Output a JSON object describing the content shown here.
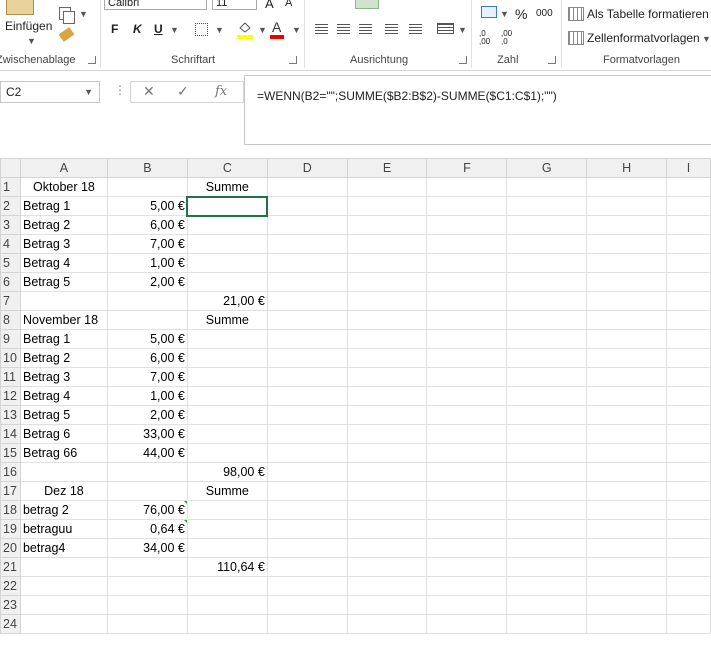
{
  "ribbon": {
    "clipboard": {
      "paste_label": "Einfügen",
      "group_label": "Zwischenablage"
    },
    "font": {
      "font_name": "Calibri",
      "font_size": "11",
      "bold": "F",
      "italic": "K",
      "underline": "U",
      "group_label": "Schriftart"
    },
    "alignment": {
      "group_label": "Ausrichtung"
    },
    "number": {
      "percent": "%",
      "thousands": "000",
      "inc_decimal": ",0 ,00",
      "dec_decimal": ",00 ,0",
      "group_label": "Zahl"
    },
    "styles": {
      "table_format": "Als Tabelle formatieren",
      "cell_styles": "Zellenformatvorlagen",
      "group_label": "Formatvorlagen"
    }
  },
  "formula_bar": {
    "name_box": "C2",
    "formula": "=WENN(B2=\"\";SUMME($B2:B$2)-SUMME($C1:C$1);\"\")"
  },
  "sheet": {
    "columns": [
      "A",
      "B",
      "C",
      "D",
      "E",
      "F",
      "G",
      "H",
      "I"
    ],
    "rows": [
      {
        "n": "1",
        "a": "Oktober 18",
        "b": "",
        "c": "Summe"
      },
      {
        "n": "2",
        "a": "Betrag 1",
        "b": "5,00 €",
        "c": ""
      },
      {
        "n": "3",
        "a": "Betrag 2",
        "b": "6,00 €",
        "c": ""
      },
      {
        "n": "4",
        "a": "Betrag 3",
        "b": "7,00 €",
        "c": ""
      },
      {
        "n": "5",
        "a": "Betrag 4",
        "b": "1,00 €",
        "c": ""
      },
      {
        "n": "6",
        "a": "Betrag 5",
        "b": "2,00 €",
        "c": ""
      },
      {
        "n": "7",
        "a": "",
        "b": "",
        "c": "21,00 €"
      },
      {
        "n": "8",
        "a": "November 18",
        "b": "",
        "c": "Summe"
      },
      {
        "n": "9",
        "a": "Betrag 1",
        "b": "5,00 €",
        "c": ""
      },
      {
        "n": "10",
        "a": "Betrag 2",
        "b": "6,00 €",
        "c": ""
      },
      {
        "n": "11",
        "a": "Betrag 3",
        "b": "7,00 €",
        "c": ""
      },
      {
        "n": "12",
        "a": "Betrag 4",
        "b": "1,00 €",
        "c": ""
      },
      {
        "n": "13",
        "a": "Betrag 5",
        "b": "2,00 €",
        "c": ""
      },
      {
        "n": "14",
        "a": "Betrag 6",
        "b": "33,00 €",
        "c": ""
      },
      {
        "n": "15",
        "a": "Betrag 66",
        "b": "44,00 €",
        "c": ""
      },
      {
        "n": "16",
        "a": "",
        "b": "",
        "c": "98,00 €"
      },
      {
        "n": "17",
        "a": "Dez 18",
        "b": "",
        "c": "Summe"
      },
      {
        "n": "18",
        "a": "betrag 2",
        "b": "76,00 €",
        "c": ""
      },
      {
        "n": "19",
        "a": "betraguu",
        "b": "0,64 €",
        "c": ""
      },
      {
        "n": "20",
        "a": "betrag4",
        "b": "34,00 €",
        "c": ""
      },
      {
        "n": "21",
        "a": "",
        "b": "",
        "c": "110,64 €"
      },
      {
        "n": "22",
        "a": "",
        "b": "",
        "c": ""
      },
      {
        "n": "23",
        "a": "",
        "b": "",
        "c": ""
      },
      {
        "n": "24",
        "a": "",
        "b": "",
        "c": ""
      }
    ]
  }
}
